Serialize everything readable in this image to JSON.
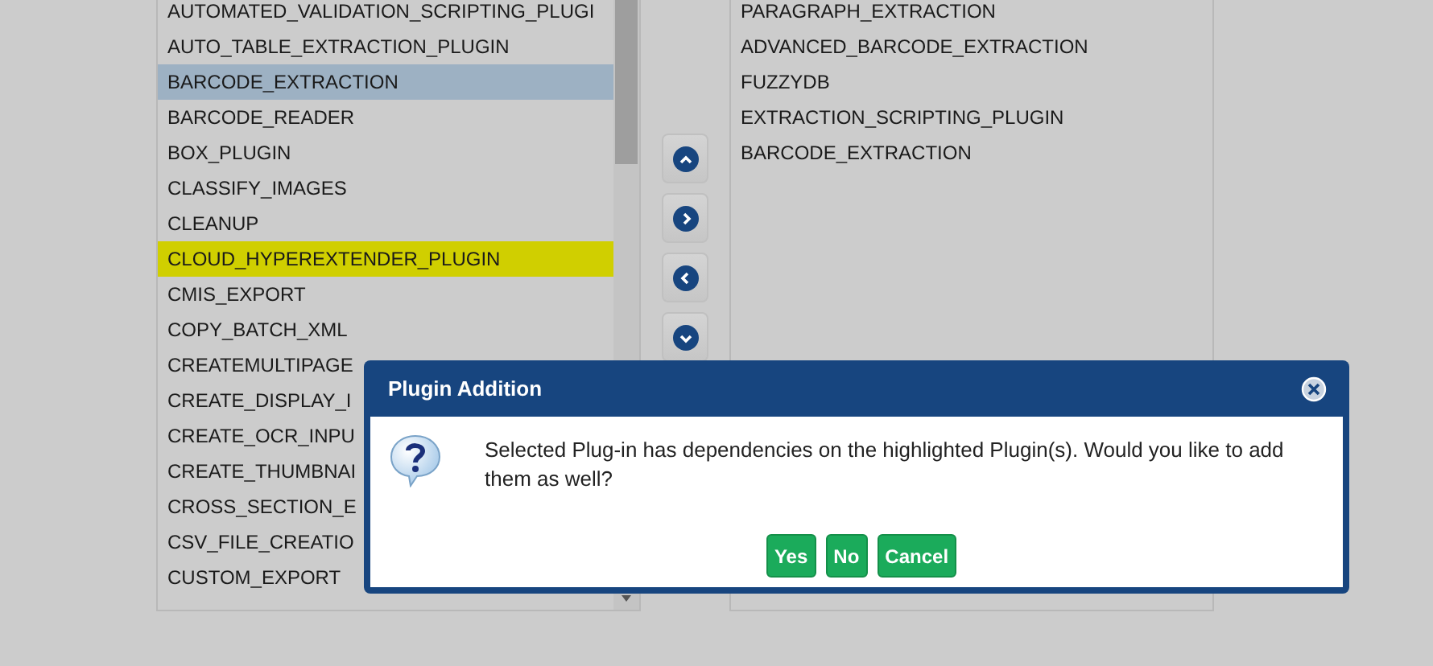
{
  "available_plugins": {
    "items": [
      {
        "label": "AUTOMATED_VALIDATION_SCRIPTING_PLUGI",
        "selected": false,
        "highlighted": false
      },
      {
        "label": "AUTO_TABLE_EXTRACTION_PLUGIN",
        "selected": false,
        "highlighted": false
      },
      {
        "label": "BARCODE_EXTRACTION",
        "selected": true,
        "highlighted": false
      },
      {
        "label": "BARCODE_READER",
        "selected": false,
        "highlighted": false
      },
      {
        "label": "BOX_PLUGIN",
        "selected": false,
        "highlighted": false
      },
      {
        "label": "CLASSIFY_IMAGES",
        "selected": false,
        "highlighted": false
      },
      {
        "label": "CLEANUP",
        "selected": false,
        "highlighted": false
      },
      {
        "label": "CLOUD_HYPEREXTENDER_PLUGIN",
        "selected": false,
        "highlighted": true
      },
      {
        "label": "CMIS_EXPORT",
        "selected": false,
        "highlighted": false
      },
      {
        "label": "COPY_BATCH_XML",
        "selected": false,
        "highlighted": false
      },
      {
        "label": "CREATEMULTIPAGE",
        "selected": false,
        "highlighted": false
      },
      {
        "label": "CREATE_DISPLAY_I",
        "selected": false,
        "highlighted": false
      },
      {
        "label": "CREATE_OCR_INPU",
        "selected": false,
        "highlighted": false
      },
      {
        "label": "CREATE_THUMBNAI",
        "selected": false,
        "highlighted": false
      },
      {
        "label": "CROSS_SECTION_E",
        "selected": false,
        "highlighted": false
      },
      {
        "label": "CSV_FILE_CREATIO",
        "selected": false,
        "highlighted": false
      },
      {
        "label": "CUSTOM_EXPORT",
        "selected": false,
        "highlighted": false
      }
    ]
  },
  "move_buttons": [
    {
      "kind": "up"
    },
    {
      "kind": "right"
    },
    {
      "kind": "left"
    },
    {
      "kind": "down"
    }
  ],
  "selected_plugins": {
    "items": [
      {
        "label": "PARAGRAPH_EXTRACTION"
      },
      {
        "label": "ADVANCED_BARCODE_EXTRACTION"
      },
      {
        "label": "FUZZYDB"
      },
      {
        "label": "EXTRACTION_SCRIPTING_PLUGIN"
      },
      {
        "label": "BARCODE_EXTRACTION"
      }
    ]
  },
  "dialog": {
    "title": "Plugin Addition",
    "message": "Selected Plug-in has dependencies on the highlighted Plugin(s). Would you like to add them as well?",
    "buttons": [
      "Yes",
      "No",
      "Cancel"
    ]
  }
}
